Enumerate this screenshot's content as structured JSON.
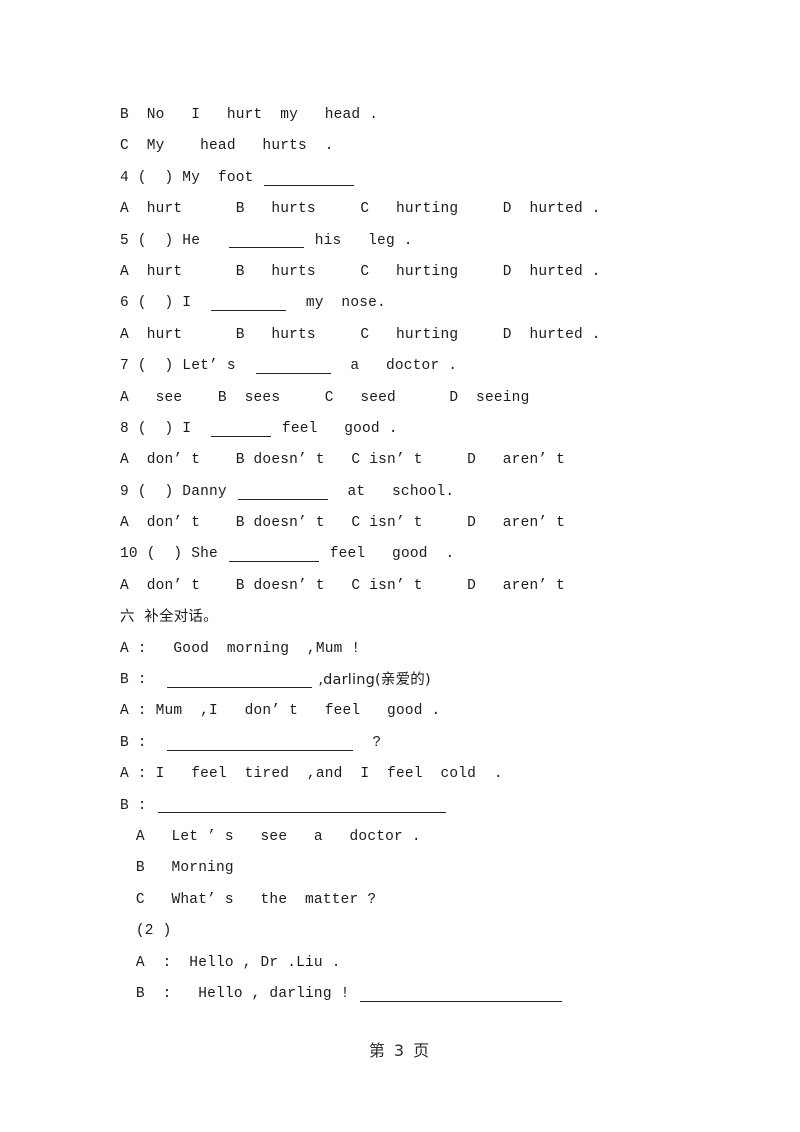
{
  "document": {
    "page_footer": "第 3 页",
    "lines": [
      {
        "id": "l1",
        "text": "B  No   I   hurt  my   head ."
      },
      {
        "id": "l2",
        "text": "C  My    head   hurts  ."
      },
      {
        "id": "l3",
        "pre": "4 (  ) My  foot ",
        "blank": "blank-lg",
        "post": ""
      },
      {
        "id": "l4",
        "text": "A  hurt      B   hurts     C   hurting     D  hurted ."
      },
      {
        "id": "l5",
        "pre": "5 (  ) He   ",
        "blank": "blank-md",
        "post": " his   leg ."
      },
      {
        "id": "l6",
        "text": "A  hurt      B   hurts     C   hurting     D  hurted ."
      },
      {
        "id": "l7",
        "pre": "6 (  ) I  ",
        "blank": "blank-md",
        "post": "  my  nose."
      },
      {
        "id": "l8",
        "text": "A  hurt      B   hurts     C   hurting     D  hurted ."
      },
      {
        "id": "l9",
        "pre": "7 (  ) Let’ s  ",
        "blank": "blank-md",
        "post": "  a   doctor ."
      },
      {
        "id": "l10",
        "text": "A   see    B  sees     C   seed      D  seeing"
      },
      {
        "id": "l11",
        "pre": "8 (  ) I  ",
        "blank": "blank-sm",
        "post": " feel   good ."
      },
      {
        "id": "l12",
        "text": "A  don’ t    B doesn’ t   C isn’ t     D   aren’ t"
      },
      {
        "id": "l13",
        "pre": "9 (  ) Danny ",
        "blank": "blank-lg",
        "post": "  at   school."
      },
      {
        "id": "l14",
        "text": "A  don’ t    B doesn’ t   C isn’ t     D   aren’ t"
      },
      {
        "id": "l15",
        "pre": "10 (  ) She ",
        "blank": "blank-lg",
        "post": " feel   good  ."
      },
      {
        "id": "l16",
        "text": "A  don’ t    B doesn’ t   C isn’ t     D   aren’ t"
      },
      {
        "id": "l17",
        "cn": true,
        "text": "六  补全对话。"
      },
      {
        "id": "l18",
        "text": "A :   Good  morning  ,Mum !"
      },
      {
        "id": "l19",
        "pre": "B :  ",
        "blank": "blank-dlg1",
        "post": " ,darling(亲爱的)",
        "cn_post": true
      },
      {
        "id": "l20",
        "text": "A : Mum  ,I   don’ t   feel   good ."
      },
      {
        "id": "l21",
        "pre": "B :  ",
        "blank": "blank-dlg2",
        "post": "  ?"
      },
      {
        "id": "l22",
        "text": "A : I   feel  tired  ,and  I  feel  cold  ."
      },
      {
        "id": "l23",
        "pre": "B : ",
        "blank": "blank-dlg3",
        "post": ""
      },
      {
        "id": "l24",
        "indent": 1,
        "text": " A   Let ’ s   see   a   doctor ."
      },
      {
        "id": "l25",
        "indent": 1,
        "text": " B   Morning"
      },
      {
        "id": "l26",
        "indent": 1,
        "text": " C   What’ s   the  matter ?"
      },
      {
        "id": "l27",
        "indent": 1,
        "text": " (2 )"
      },
      {
        "id": "l28",
        "indent": 1,
        "text": " A  :  Hello , Dr .Liu ."
      },
      {
        "id": "l29",
        "indent": 1,
        "pre": " B  :   Hello , darling ! ",
        "blank": "blank-dlg4",
        "post": ""
      }
    ]
  }
}
